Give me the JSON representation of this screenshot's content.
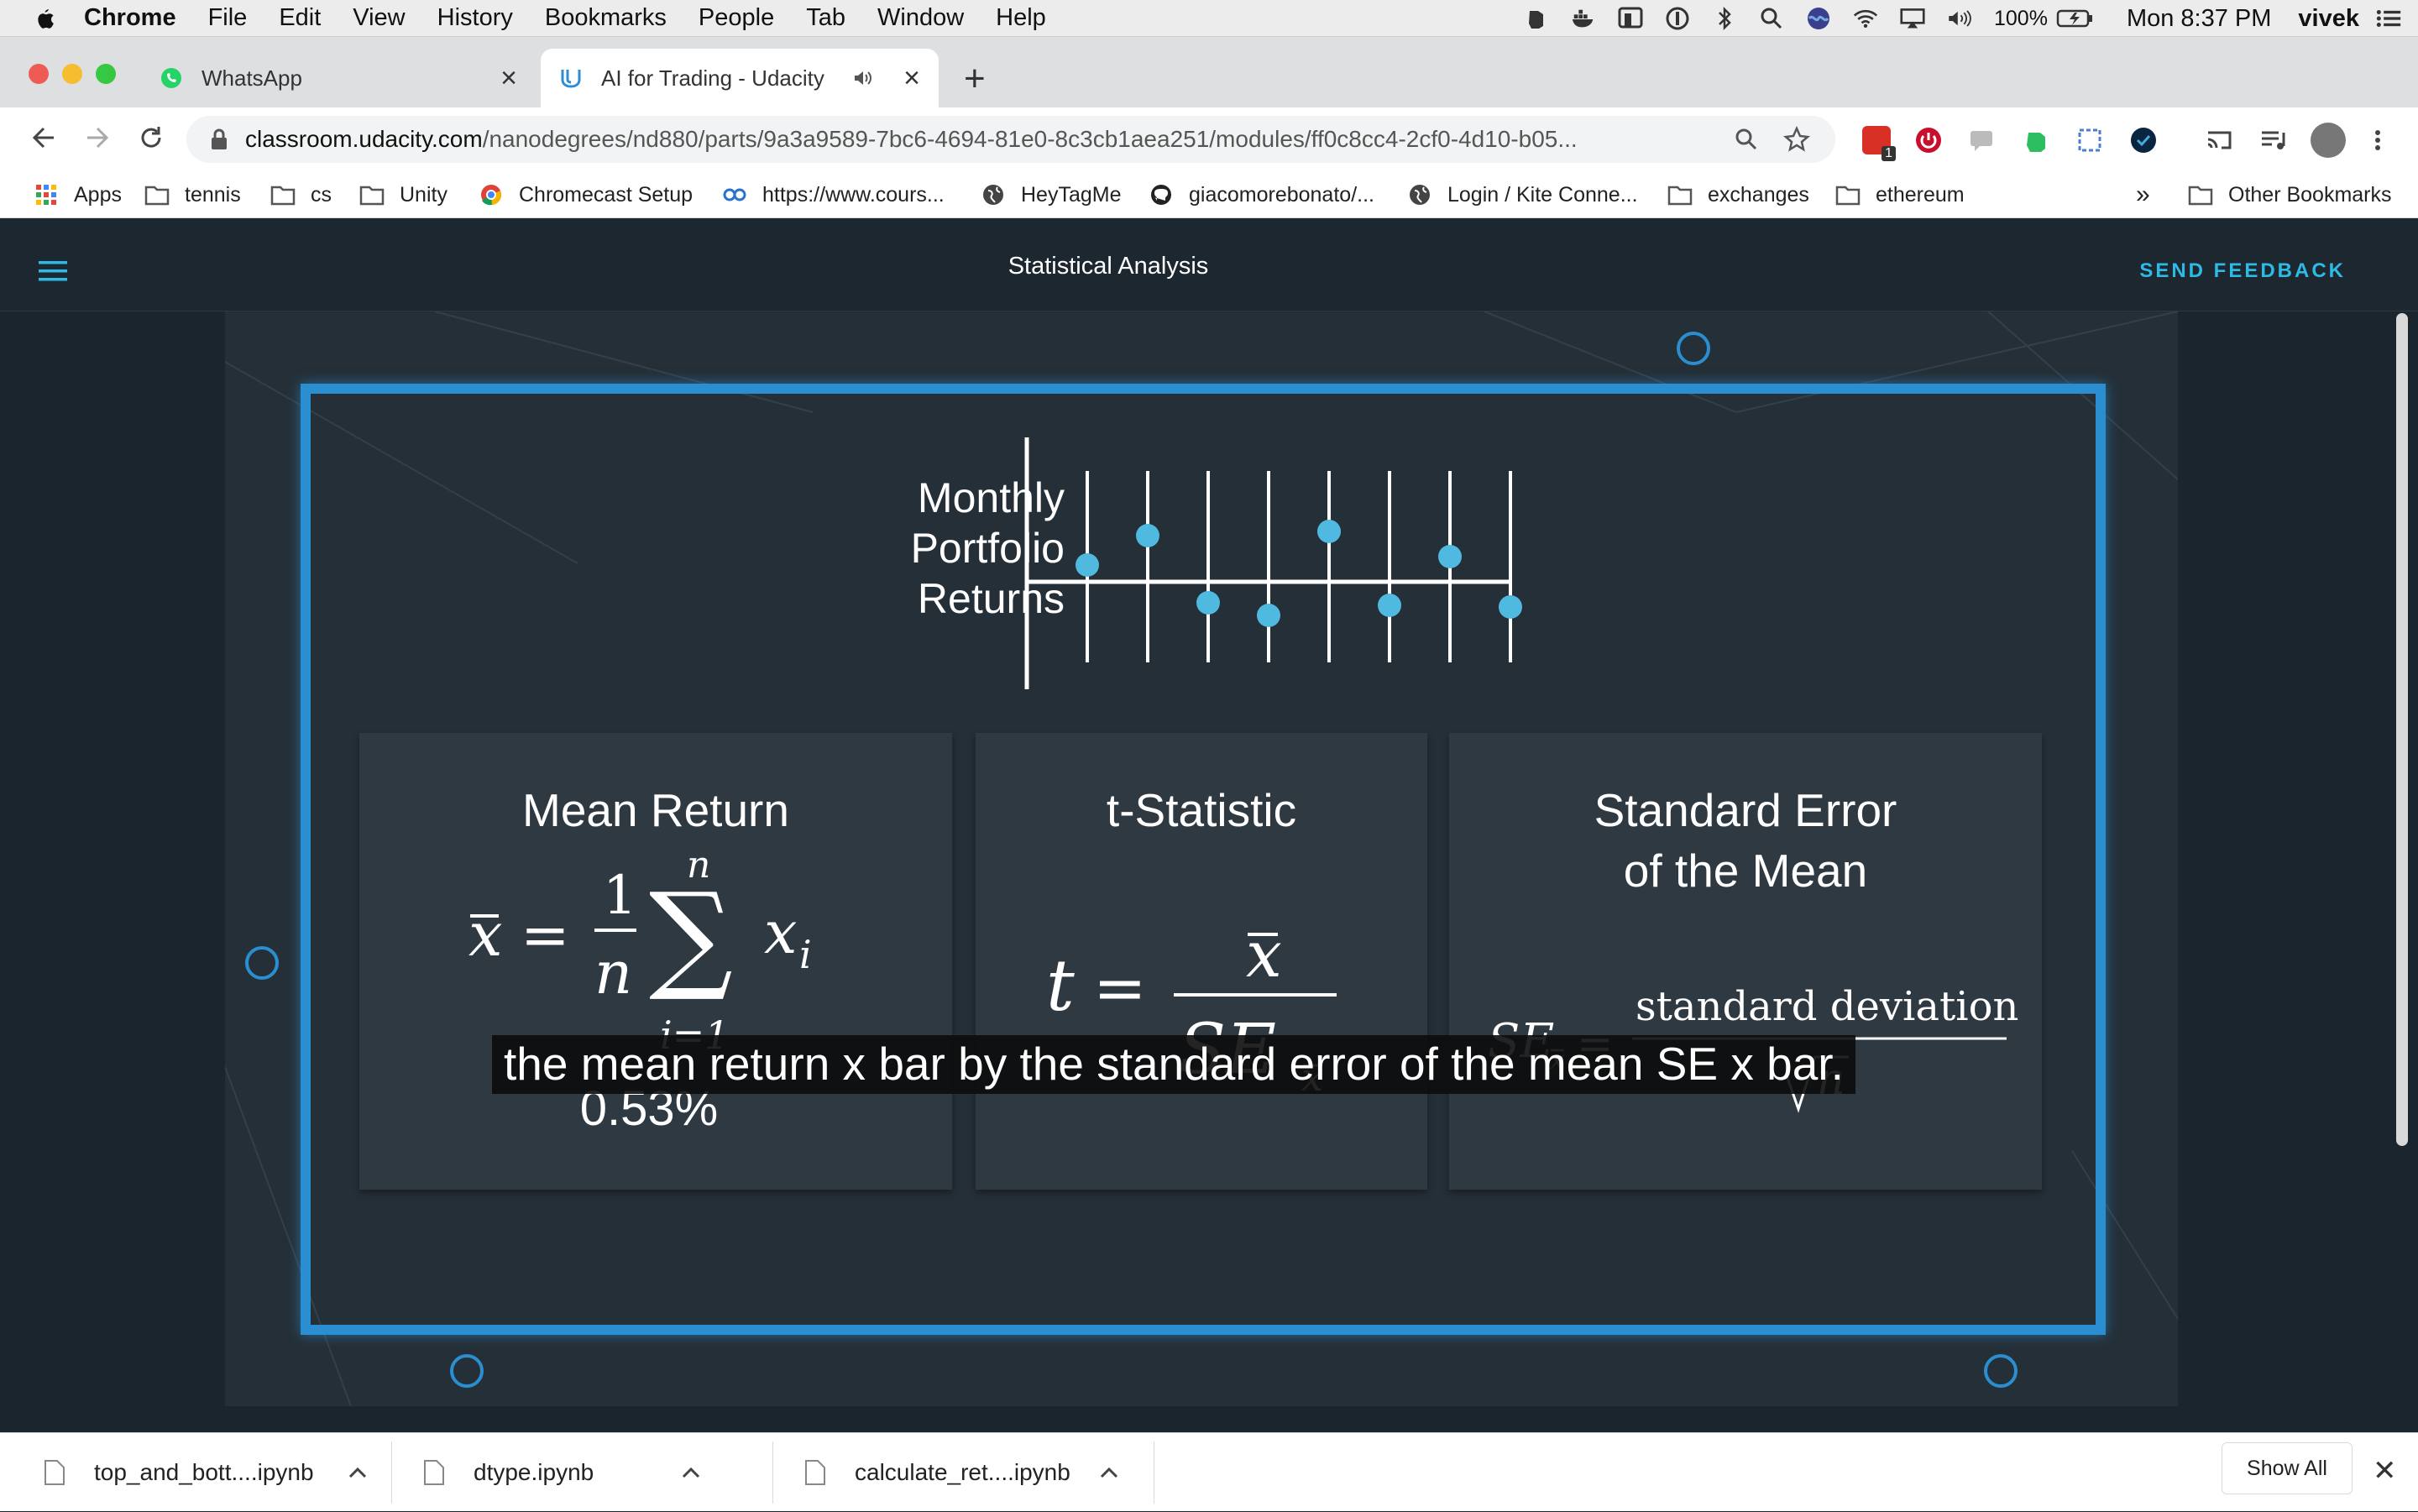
{
  "menubar": {
    "app_name": "Chrome",
    "items": [
      "File",
      "Edit",
      "View",
      "History",
      "Bookmarks",
      "People",
      "Tab",
      "Window",
      "Help"
    ],
    "battery": "100%",
    "clock": "Mon 8:37 PM",
    "user": "vivek"
  },
  "tabs": [
    {
      "title": "WhatsApp",
      "icon": "whatsapp-icon"
    },
    {
      "title": "AI for Trading - Udacity",
      "icon": "udacity-icon"
    }
  ],
  "omnibox": {
    "host": "classroom.udacity.com",
    "path": "/nanodegrees/nd880/parts/9a3a9589-7bc6-4694-81e0-8c3cb1aea251/modules/ff0c8cc4-2cf0-4d10-b05..."
  },
  "extension_badge": "1",
  "bookmarks": {
    "items": [
      "Apps",
      "tennis",
      "cs",
      "Unity",
      "Chromecast Setup",
      "https://www.cours...",
      "HeyTagMe",
      "giacomorebonato/...",
      "Login / Kite Conne...",
      "exchanges",
      "ethereum"
    ],
    "overflow": "»",
    "other": "Other Bookmarks"
  },
  "page": {
    "title": "Statistical Analysis",
    "feedback": "SEND FEEDBACK"
  },
  "slide": {
    "chart_label_lines": [
      "Monthly",
      "Portfolio",
      "Returns"
    ],
    "chart_data": {
      "type": "scatter",
      "title": "",
      "series": [
        {
          "values": [
            0.2,
            0.55,
            -0.25,
            -0.4,
            0.6,
            -0.28,
            0.3,
            -0.3
          ]
        }
      ]
    },
    "panels": [
      {
        "title_lines": [
          "Mean Return"
        ],
        "value": "0.53%"
      },
      {
        "title_lines": [
          "t-Statistic"
        ]
      },
      {
        "title_lines": [
          "Standard Error",
          "of the Mean"
        ],
        "numerator": "standard deviation"
      }
    ],
    "caption": "the mean return x bar by the standard error of the mean SE x bar."
  },
  "downloads": [
    {
      "name": "top_and_bott....ipynb"
    },
    {
      "name": "dtype.ipynb"
    },
    {
      "name": "calculate_ret....ipynb"
    }
  ],
  "shelf": {
    "show_all": "Show All"
  },
  "colors": {
    "accent": "#2dbbe6",
    "frame": "#2a8ed0",
    "dots": "#4fb9e0"
  }
}
